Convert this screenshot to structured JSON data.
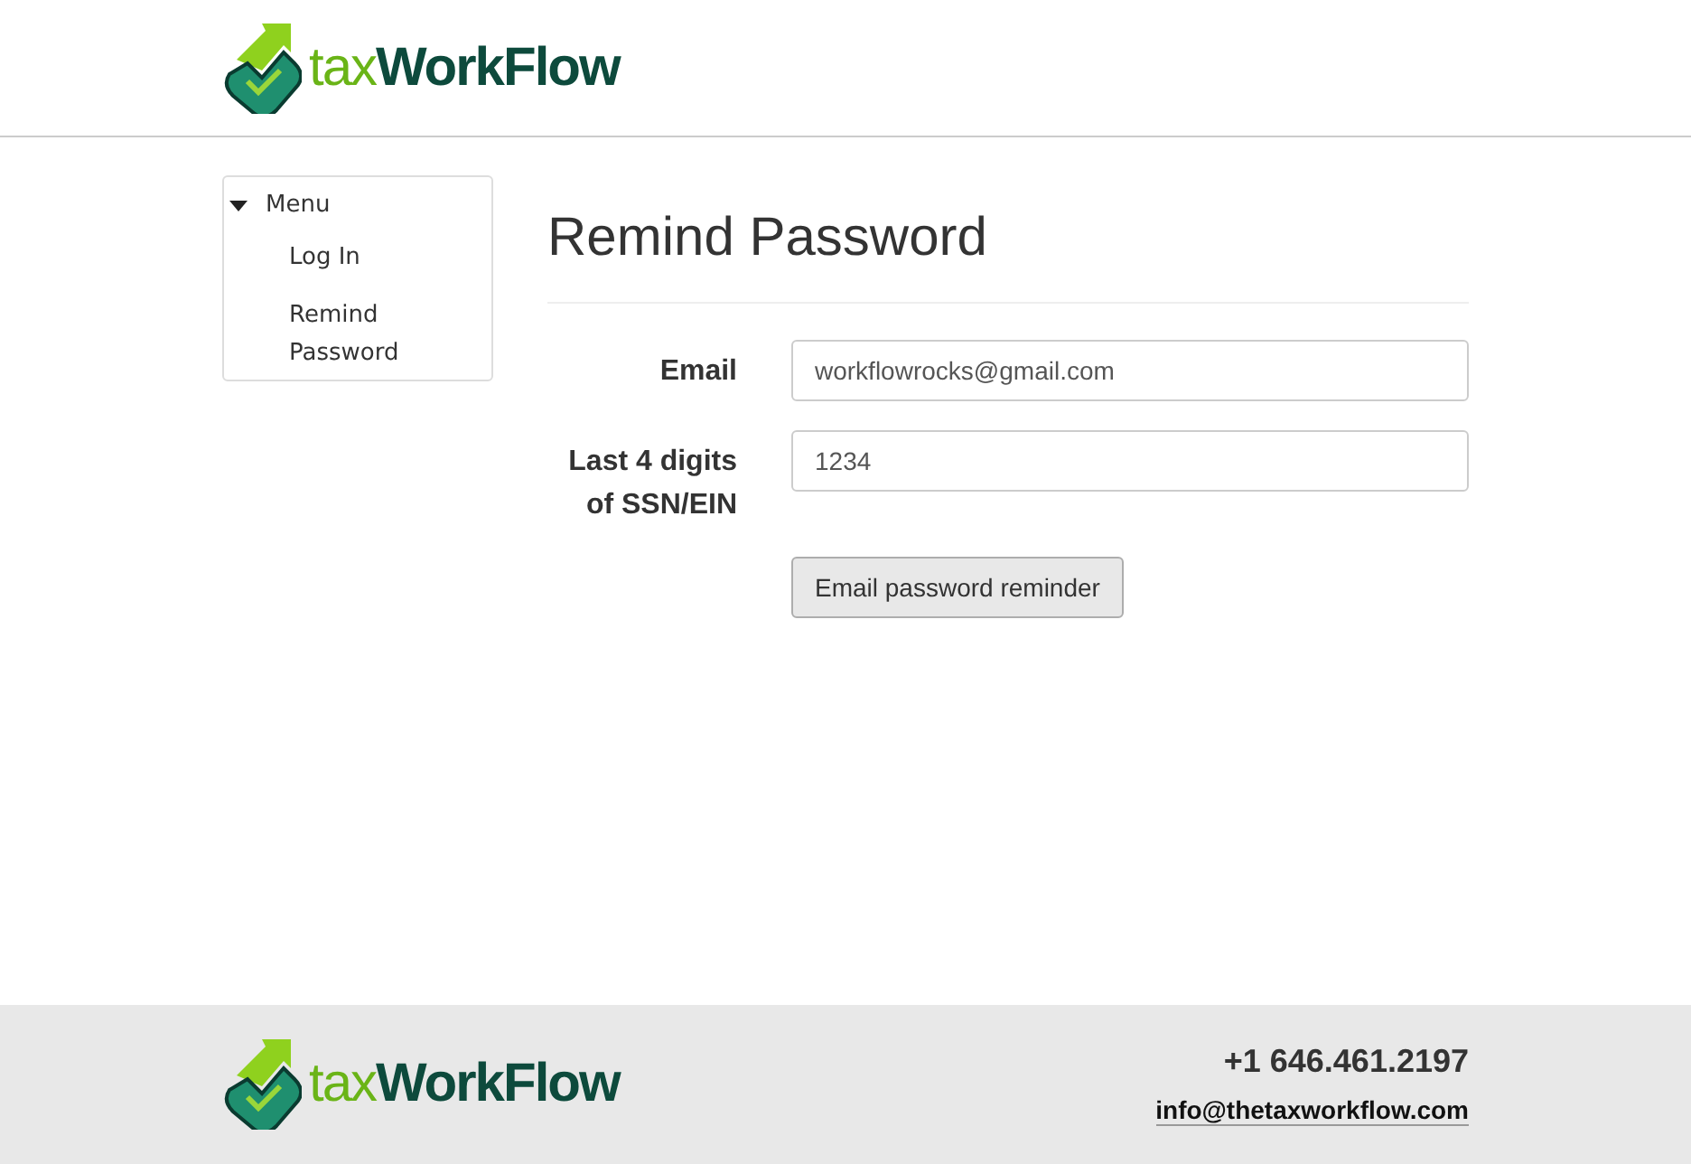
{
  "header": {
    "logo": {
      "prefix": "tax",
      "name": "WorkFlow"
    }
  },
  "sidebar": {
    "title": "Menu",
    "expanded": true,
    "items": [
      {
        "label": "Log In"
      },
      {
        "label": "Remind Password"
      }
    ]
  },
  "page": {
    "title": "Remind Password",
    "fields": [
      {
        "label": "Email",
        "value": "workflowrocks@gmail.com"
      },
      {
        "label": "Last 4 digits of SSN/EIN",
        "value": "1234"
      }
    ],
    "button": "Email password reminder"
  },
  "footer": {
    "logo": {
      "prefix": "tax",
      "name": "WorkFlow"
    },
    "phone": "+1 646.461.2197",
    "email": "info@thetaxworkflow.com"
  }
}
